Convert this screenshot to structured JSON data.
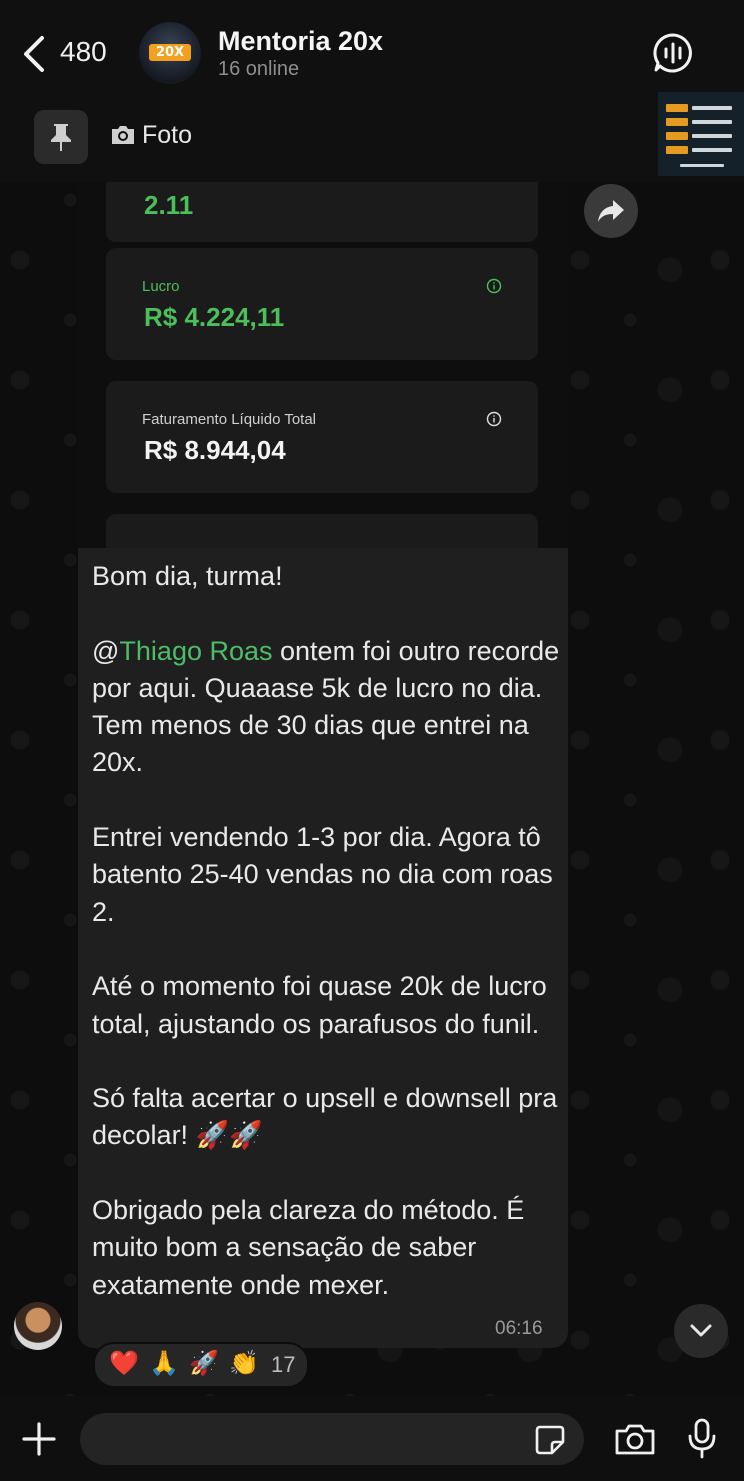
{
  "header": {
    "back_count": "480",
    "group_logo": "20X",
    "group_name": "Mentoria 20x",
    "status": "16 online"
  },
  "pinned": {
    "label": "Foto"
  },
  "image_message": {
    "cards": [
      {
        "label": "",
        "value": "2.11",
        "label_color": "#4cbf5a",
        "value_color": "#4cbf5a"
      },
      {
        "label": "Lucro",
        "value": "R$ 4.224,11",
        "label_color": "#4cbf5a",
        "value_color": "#4cbf5a"
      },
      {
        "label": "Faturamento Líquido Total",
        "value": "R$ 8.944,04",
        "label_color": "#cfcfcf",
        "value_color": "#f3f3f3"
      },
      {
        "label": "",
        "value": "",
        "label_color": "#cfcfcf",
        "value_color": "#f3f3f3"
      }
    ]
  },
  "message": {
    "line1": "Bom dia, turma!",
    "mention_at": "@",
    "mention_name": "Thiago Roas",
    "p1_rest": " ontem foi outro recorde por aqui. Quaaase 5k de lucro no dia. Tem menos de 30 dias que entrei na 20x.",
    "p2": "Entrei vendendo 1-3 por dia. Agora tô batento 25-40 vendas no dia com roas 2.",
    "p3": "Até o momento foi quase 20k de lucro total, ajustando os parafusos do funil.",
    "p4": "Só falta acertar o upsell e downsell pra decolar! 🚀🚀",
    "p5": "Obrigado pela clareza do método. É muito bom a sensação de saber exatamente onde mexer.",
    "time": "06:16"
  },
  "reactions": {
    "emojis": [
      "❤️",
      "🙏",
      "🚀",
      "👏"
    ],
    "count": "17"
  },
  "colors": {
    "accent_green": "#4cbf5a",
    "mention": "#4dbd6a",
    "bubble": "#1f1f1f"
  },
  "icons": {
    "back": "chevron-left-icon",
    "voice_chat": "voice-chat-icon",
    "pin": "pin-icon",
    "camera": "camera-icon",
    "forward": "forward-icon",
    "scroll_down": "chevron-down-icon",
    "plus": "plus-icon",
    "sticker": "sticker-icon",
    "mic": "mic-icon"
  }
}
